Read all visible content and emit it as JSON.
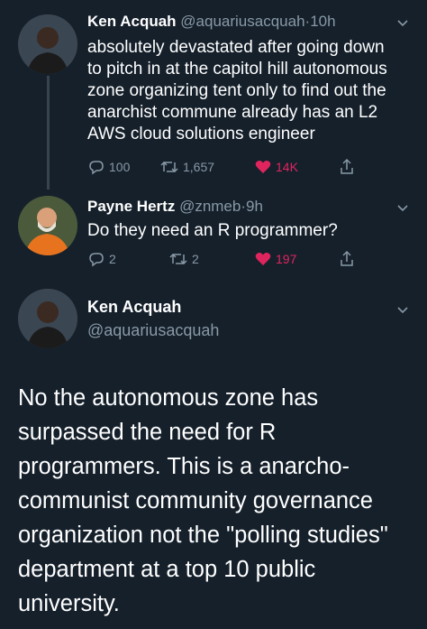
{
  "thread": [
    {
      "name": "Ken Acquah",
      "handle": "@aquariusacquah",
      "dot": "·",
      "time": "10h",
      "lines": [
        "absolutely devastated after going down",
        "to pitch in at the capitol hill autonomous",
        "zone organizing tent only to find out the",
        "anarchist commune already has an L2",
        "AWS cloud solutions engineer"
      ],
      "replies": "100",
      "retweets": "1,657",
      "likes": "14K"
    },
    {
      "name": "Payne Hertz",
      "handle": "@znmeb",
      "dot": "·",
      "time": "9h",
      "lines": [
        "Do they need an R programmer?"
      ],
      "replies": "2",
      "retweets": "2",
      "likes": "197"
    }
  ],
  "focus_tweet": {
    "name": "Ken Acquah",
    "handle": "@aquariusacquah",
    "lines": [
      "No the autonomous zone has",
      "surpassed the need for R",
      "programmers. This is a anarcho-",
      "communist community governance",
      "organization not the \"polling studies\"",
      "department at a top 10 public",
      "university."
    ]
  },
  "colors": {
    "background": "#15202b",
    "secondary_text": "#8899a6",
    "like_red": "#e0245e",
    "thread_line": "#38444d"
  },
  "icons": [
    "reply-icon",
    "retweet-icon",
    "like-icon",
    "share-icon",
    "chevron-down-icon"
  ]
}
